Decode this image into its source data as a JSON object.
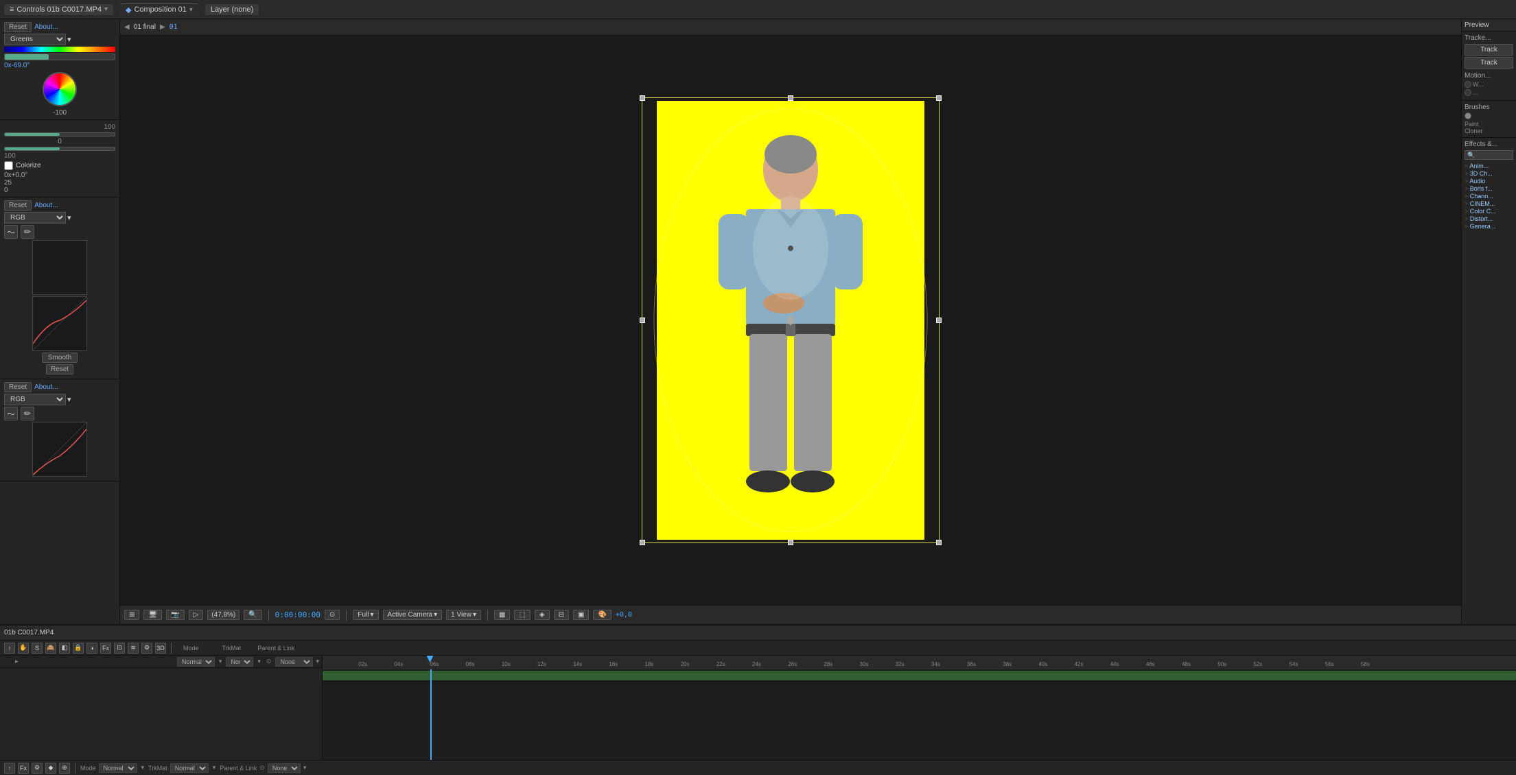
{
  "app": {
    "title": "Adobe After Effects"
  },
  "tabs": [
    {
      "id": "footage",
      "label": "Controls 01b C0017.MP4",
      "icon": "≡",
      "active": false
    },
    {
      "id": "composition",
      "label": "Composition 01",
      "icon": "◆",
      "active": true
    },
    {
      "id": "layer",
      "label": "Layer (none)",
      "active": false
    }
  ],
  "comp_nav": {
    "comp_name": "01 final",
    "frame_number": "01"
  },
  "left_panel": {
    "reset_label": "Reset",
    "about_label": "About...",
    "greens_label": "Greens",
    "angle_value": "0x-69.0°",
    "value_neg100": "-100",
    "value_0": "0",
    "range_max": "100",
    "colorize_label": "Colorize",
    "colorize_value": "0x+0.0°",
    "small_val_25": "25",
    "small_val_0": "0",
    "rgb_label": "RGB",
    "smooth_label": "Smooth",
    "reset_label2": "Reset"
  },
  "viewport": {
    "zoom_label": "(47,8%)",
    "timecode": "0:00:00:00",
    "quality_label": "Full",
    "camera_label": "Active Camera",
    "view_label": "1 View",
    "offset_label": "+0,0"
  },
  "right_panel": {
    "tracker_title": "Tracke...",
    "track_btn1": "Track",
    "track_btn2": "Track",
    "motion_label": "Motion...",
    "brushes_title": "Brushes",
    "paint_label": "Paint",
    "cloner_label": "Cloner",
    "effects_title": "Effects &...",
    "effects_search_placeholder": "Search",
    "effects_items": [
      "Anim...",
      "3D Ch...",
      "Audio",
      "Boris f...",
      "Chann...",
      "CINEM...",
      "Color C...",
      "Distort...",
      "Genera..."
    ]
  },
  "timeline": {
    "comp_label": "01b C0017.MP4",
    "time_markers": [
      "02s",
      "04s",
      "06s",
      "08s",
      "10s",
      "12s",
      "14s",
      "16s",
      "18s",
      "20s",
      "22s",
      "24s",
      "26s",
      "28s",
      "30s",
      "32s",
      "34s",
      "36s",
      "38s",
      "40s",
      "42s",
      "44s",
      "46s",
      "48s",
      "50s",
      "52s",
      "54s",
      "56s",
      "58s"
    ],
    "layers": [
      {
        "index": "",
        "name": "",
        "mode": "Normal",
        "trimat": "Normal",
        "parent": "None"
      }
    ],
    "column_headers": {
      "mode": "Mode",
      "trimat": "TrkMat",
      "parent": "Parent & Link"
    }
  },
  "bottom_toolbar": {
    "mode_label": "Mode",
    "normal_label": "Normal",
    "trimat_label": "TrkMat",
    "parent_label": "Parent & Link",
    "none_label": "None"
  }
}
